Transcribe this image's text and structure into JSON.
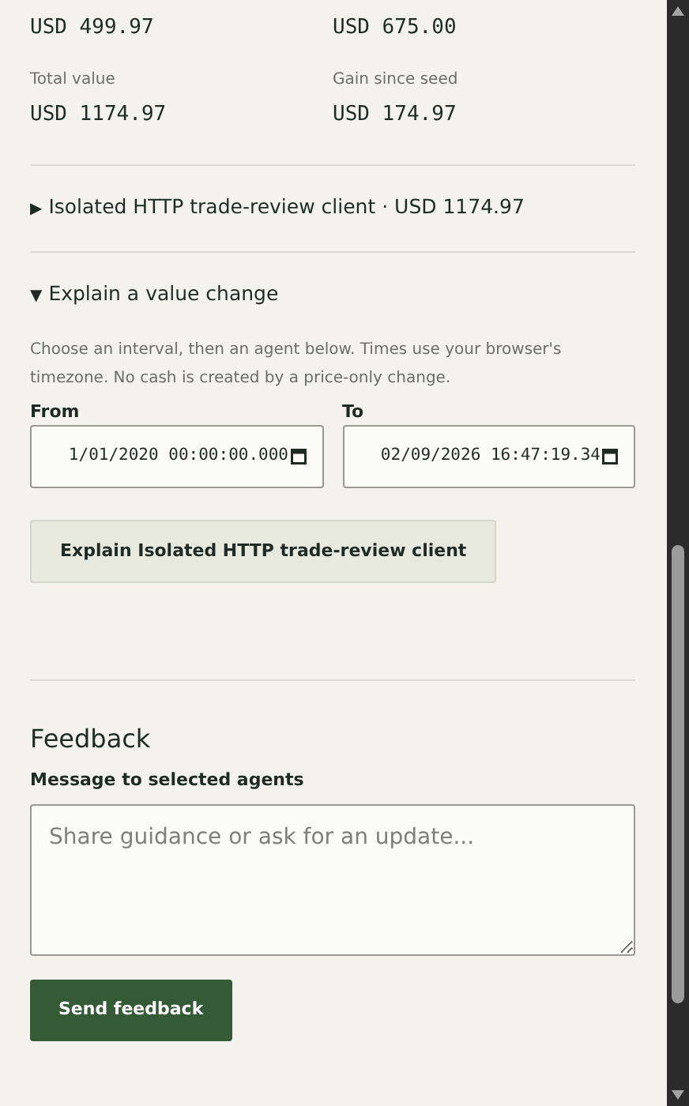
{
  "top_values": [
    "USD 499.97",
    "USD 675.00"
  ],
  "metrics": [
    {
      "label": "Total value",
      "value": "USD 1174.97"
    },
    {
      "label": "Gain since seed",
      "value": "USD 174.97"
    }
  ],
  "sections": [
    {
      "marker": "▶",
      "title": "Isolated HTTP trade-review client · USD 1174.97",
      "expanded": false
    },
    {
      "marker": "▼",
      "title": "Explain a value change",
      "expanded": true
    }
  ],
  "explain": {
    "hint": "Choose an interval, then an agent below. Times use your browser's timezone. No cash is created by a price-only change.",
    "fields": [
      {
        "label": "From",
        "value": "1/01/2020 00:00:00.000"
      },
      {
        "label": "To",
        "value": "02/09/2026 16:47:19.34"
      }
    ],
    "button": "Explain Isolated HTTP trade-review client"
  },
  "feedback": {
    "title": "Feedback",
    "label": "Message to selected agents",
    "placeholder": "Share guidance or ask for an update...",
    "button": "Send feedback"
  }
}
